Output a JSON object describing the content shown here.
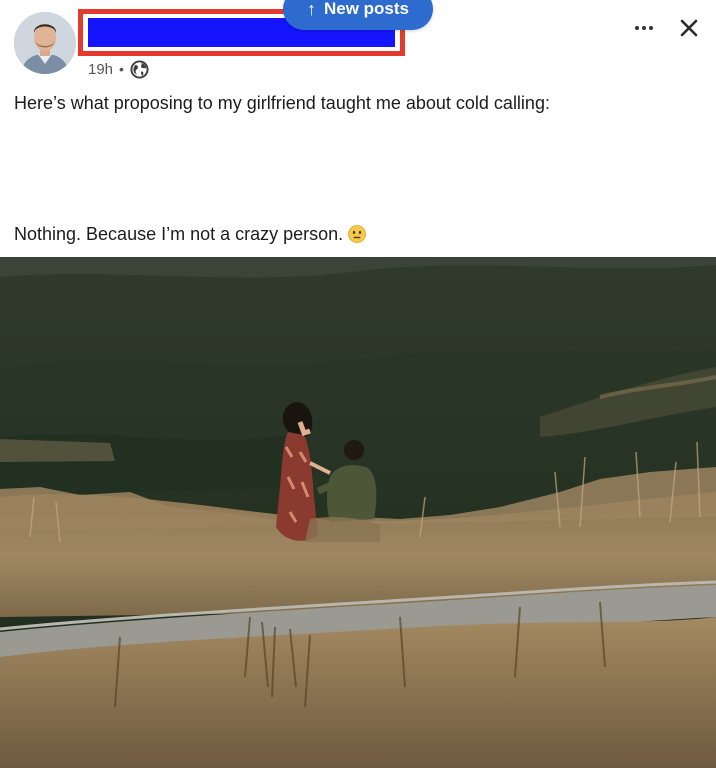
{
  "banner": {
    "label": "New posts",
    "icon": "arrow-up-icon"
  },
  "author": {
    "avatar": "avatar-photo",
    "name_redacted": true
  },
  "post": {
    "time": "19h",
    "separator": "•",
    "visibility_icon": "globe-icon",
    "text_line_1": "Here’s what proposing to my girlfriend taught me about cold calling:",
    "text_line_2": "Nothing. Because I’m not a crazy person.",
    "emoji": "neutral-face-emoji"
  },
  "controls": {
    "more_icon": "more-horizontal-icon",
    "close_icon": "close-icon"
  },
  "colors": {
    "banner_blue": "#2d6bcf",
    "redaction_blue": "#1414ff",
    "redaction_border": "#e43a2d"
  },
  "photo": {
    "subject": "proposal-photo"
  }
}
